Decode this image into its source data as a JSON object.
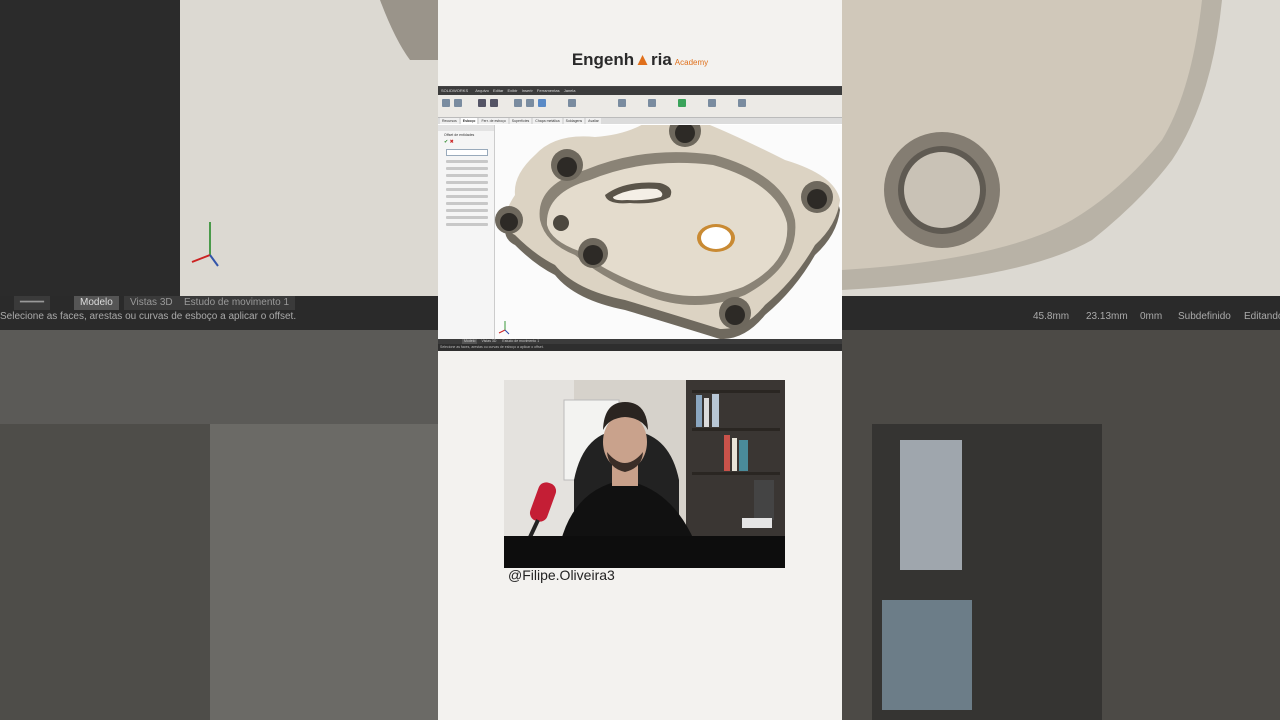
{
  "brand": {
    "name_part1": "Engenh",
    "name_part2": "ria",
    "name_sub": "Academy",
    "accent": "#e0701b"
  },
  "cad": {
    "app_name": "SOLIDWORKS",
    "menu": [
      "Arquivo",
      "Editar",
      "Exibir",
      "Inserir",
      "Ferramentas",
      "Janela"
    ],
    "tabs": [
      "Recursos",
      "Esboço",
      "Ferr. de esboço",
      "Superfícies",
      "Chapa metálica",
      "Soldagens",
      "Avaliar"
    ],
    "feature": {
      "title": "Offset de entidades"
    },
    "status_tabs": [
      "Modelo",
      "Vistas 3D",
      "Estudo de movimento 1"
    ],
    "status_message": "Selecione as faces, arestas ou curvas de esboço a aplicar o offset.",
    "status_values": [
      "45.8mm",
      "23.13mm",
      "0mm",
      "Subdefinido",
      "Editando"
    ]
  },
  "creator": {
    "handle": "@Filipe.Oliveira3"
  },
  "colors": {
    "part": "#d8cfbf",
    "part_side": "#7a7468",
    "background": "#f3f2ef"
  }
}
